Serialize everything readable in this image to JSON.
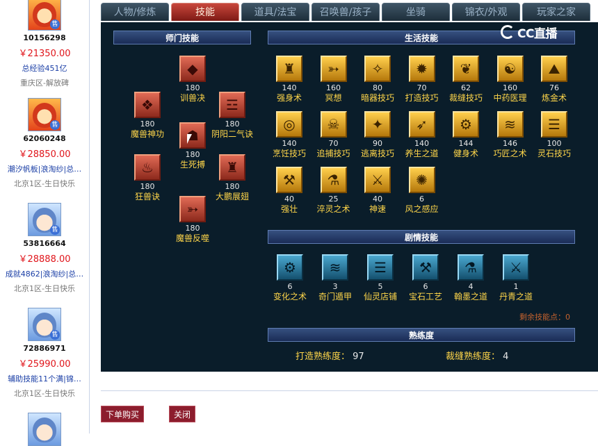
{
  "tabs": [
    {
      "label": "人物/修炼",
      "active": false
    },
    {
      "label": "技能",
      "active": true
    },
    {
      "label": "道具/法宝",
      "active": false
    },
    {
      "label": "召唤兽/孩子",
      "active": false
    },
    {
      "label": "坐骑",
      "active": false
    },
    {
      "label": "锦衣/外观",
      "active": false
    },
    {
      "label": "玩家之家",
      "active": false
    }
  ],
  "watermark": "CC直播",
  "sellers": [
    {
      "id": "10156298",
      "price": "￥21350.00",
      "info": "总经验451亿",
      "server": "重庆区-解放碑",
      "avatar": "red-hair-avatar",
      "badge": "售"
    },
    {
      "id": "62060248",
      "price": "￥28850.00",
      "info": "潮汐帆板|浪淘纱|总…",
      "server": "北京1区-生日快乐",
      "avatar": "red-hair-avatar",
      "badge": "售"
    },
    {
      "id": "53816664",
      "price": "￥28888.00",
      "info": "成就4862|浪淘纱|总…",
      "server": "北京1区-生日快乐",
      "avatar": "blue-hair-avatar",
      "badge": "售"
    },
    {
      "id": "72886971",
      "price": "￥25990.00",
      "info": "辅助技能11个满|锦…",
      "server": "北京1区-生日快乐",
      "avatar": "blue-hair-avatar",
      "badge": "售"
    }
  ],
  "sections": {
    "school": "师门技能",
    "life": "生活技能",
    "story": "剧情技能",
    "proficiency": "熟练度"
  },
  "school_skills": [
    {
      "name": "训兽决",
      "level": "180",
      "icon": "whip-icon"
    },
    {
      "name": "魔兽神功",
      "level": "180",
      "icon": "beast-mask-icon"
    },
    {
      "name": "阴阳二气诀",
      "level": "180",
      "icon": "yinyang-mask-icon"
    },
    {
      "name": "生死搏",
      "level": "180",
      "icon": "crossed-blades-icon"
    },
    {
      "name": "狂兽诀",
      "level": "180",
      "icon": "beast-totem-icon"
    },
    {
      "name": "大鹏展翅",
      "level": "180",
      "icon": "roc-wings-icon"
    },
    {
      "name": "魔兽反噬",
      "level": "180",
      "icon": "demon-head-icon"
    }
  ],
  "life_skills": [
    {
      "name": "强身术",
      "level": "140",
      "icon": "strength-icon"
    },
    {
      "name": "冥想",
      "level": "160",
      "icon": "meditation-icon"
    },
    {
      "name": "暗器技巧",
      "level": "80",
      "icon": "dart-icon"
    },
    {
      "name": "打造技巧",
      "level": "70",
      "icon": "forge-icon"
    },
    {
      "name": "裁缝技巧",
      "level": "62",
      "icon": "scissors-icon"
    },
    {
      "name": "中药医理",
      "level": "160",
      "icon": "herb-icon"
    },
    {
      "name": "炼金术",
      "level": "76",
      "icon": "alchemy-icon"
    },
    {
      "name": "烹饪技巧",
      "level": "140",
      "icon": "cooking-icon"
    },
    {
      "name": "追捕技巧",
      "level": "70",
      "icon": "chase-icon"
    },
    {
      "name": "逃离技巧",
      "level": "90",
      "icon": "escape-icon"
    },
    {
      "name": "养生之道",
      "level": "140",
      "icon": "health-icon"
    },
    {
      "name": "健身术",
      "level": "144",
      "icon": "fitness-icon"
    },
    {
      "name": "巧匠之术",
      "level": "146",
      "icon": "craftsman-icon"
    },
    {
      "name": "灵石技巧",
      "level": "100",
      "icon": "spirit-stone-icon"
    },
    {
      "name": "强壮",
      "level": "40",
      "icon": "muscle-icon"
    },
    {
      "name": "淬灵之术",
      "level": "25",
      "icon": "quench-icon"
    },
    {
      "name": "神速",
      "level": "40",
      "icon": "speed-icon"
    },
    {
      "name": "风之感应",
      "level": "6",
      "icon": "wind-icon"
    }
  ],
  "story_skills": [
    {
      "name": "变化之术",
      "level": "6",
      "icon": "transform-icon"
    },
    {
      "name": "奇门遁甲",
      "level": "3",
      "icon": "qimen-icon"
    },
    {
      "name": "仙灵店铺",
      "level": "5",
      "icon": "shop-icon"
    },
    {
      "name": "宝石工艺",
      "level": "6",
      "icon": "gem-icon"
    },
    {
      "name": "翰墨之道",
      "level": "4",
      "icon": "ink-icon"
    },
    {
      "name": "丹青之道",
      "level": "1",
      "icon": "painting-icon"
    }
  ],
  "remaining_points": {
    "label": "剩余技能点：",
    "value": "0"
  },
  "proficiency": {
    "forge_label": "打造熟练度：",
    "forge_value": "97",
    "tailor_label": "裁缝熟练度：",
    "tailor_value": "4"
  },
  "buttons": {
    "buy": "下单购买",
    "close": "关闭"
  },
  "icon_glyphs": [
    "⚒",
    "☗",
    "✦",
    "✂",
    "❦",
    "⚗",
    "♨",
    "➶",
    "⛏",
    "☯",
    "⚔",
    "♜",
    "⚙",
    "◆",
    "⛰",
    "✺",
    "➳",
    "≋",
    "❖",
    "◎",
    "✪",
    "✧",
    "☰",
    "☲",
    "☠",
    "⚡",
    "✹"
  ]
}
